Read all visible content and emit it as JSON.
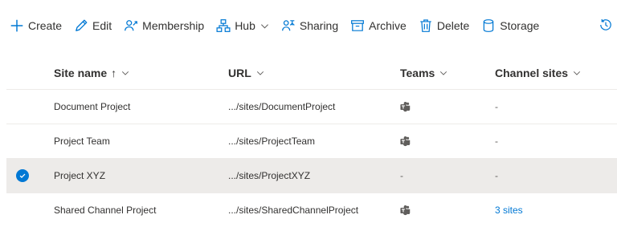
{
  "toolbar": {
    "create": "Create",
    "edit": "Edit",
    "membership": "Membership",
    "hub": "Hub",
    "sharing": "Sharing",
    "archive": "Archive",
    "delete": "Delete",
    "storage": "Storage"
  },
  "table": {
    "columns": {
      "site_name": "Site name",
      "sort_arrow": "↑",
      "url": "URL",
      "teams": "Teams",
      "channel_sites": "Channel sites"
    },
    "rows": [
      {
        "name": "Document Project",
        "url": ".../sites/DocumentProject",
        "teams": "icon",
        "channel_sites": "-",
        "selected": false
      },
      {
        "name": "Project Team",
        "url": ".../sites/ProjectTeam",
        "teams": "icon",
        "channel_sites": "-",
        "selected": false
      },
      {
        "name": "Project XYZ",
        "url": ".../sites/ProjectXYZ",
        "teams": "-",
        "channel_sites": "-",
        "selected": true
      },
      {
        "name": "Shared Channel Project",
        "url": ".../sites/SharedChannelProject",
        "teams": "icon",
        "channel_sites": "3 sites",
        "selected": false
      }
    ]
  },
  "colors": {
    "accent": "#0078d4",
    "selected_row": "#edebe9",
    "text": "#323130"
  },
  "icons": [
    "plus-icon",
    "pencil-icon",
    "people-icon",
    "hub-icon",
    "chevron-down-icon",
    "sharing-icon",
    "archive-icon",
    "trash-icon",
    "storage-icon",
    "history-icon",
    "teams-icon",
    "check-icon"
  ]
}
